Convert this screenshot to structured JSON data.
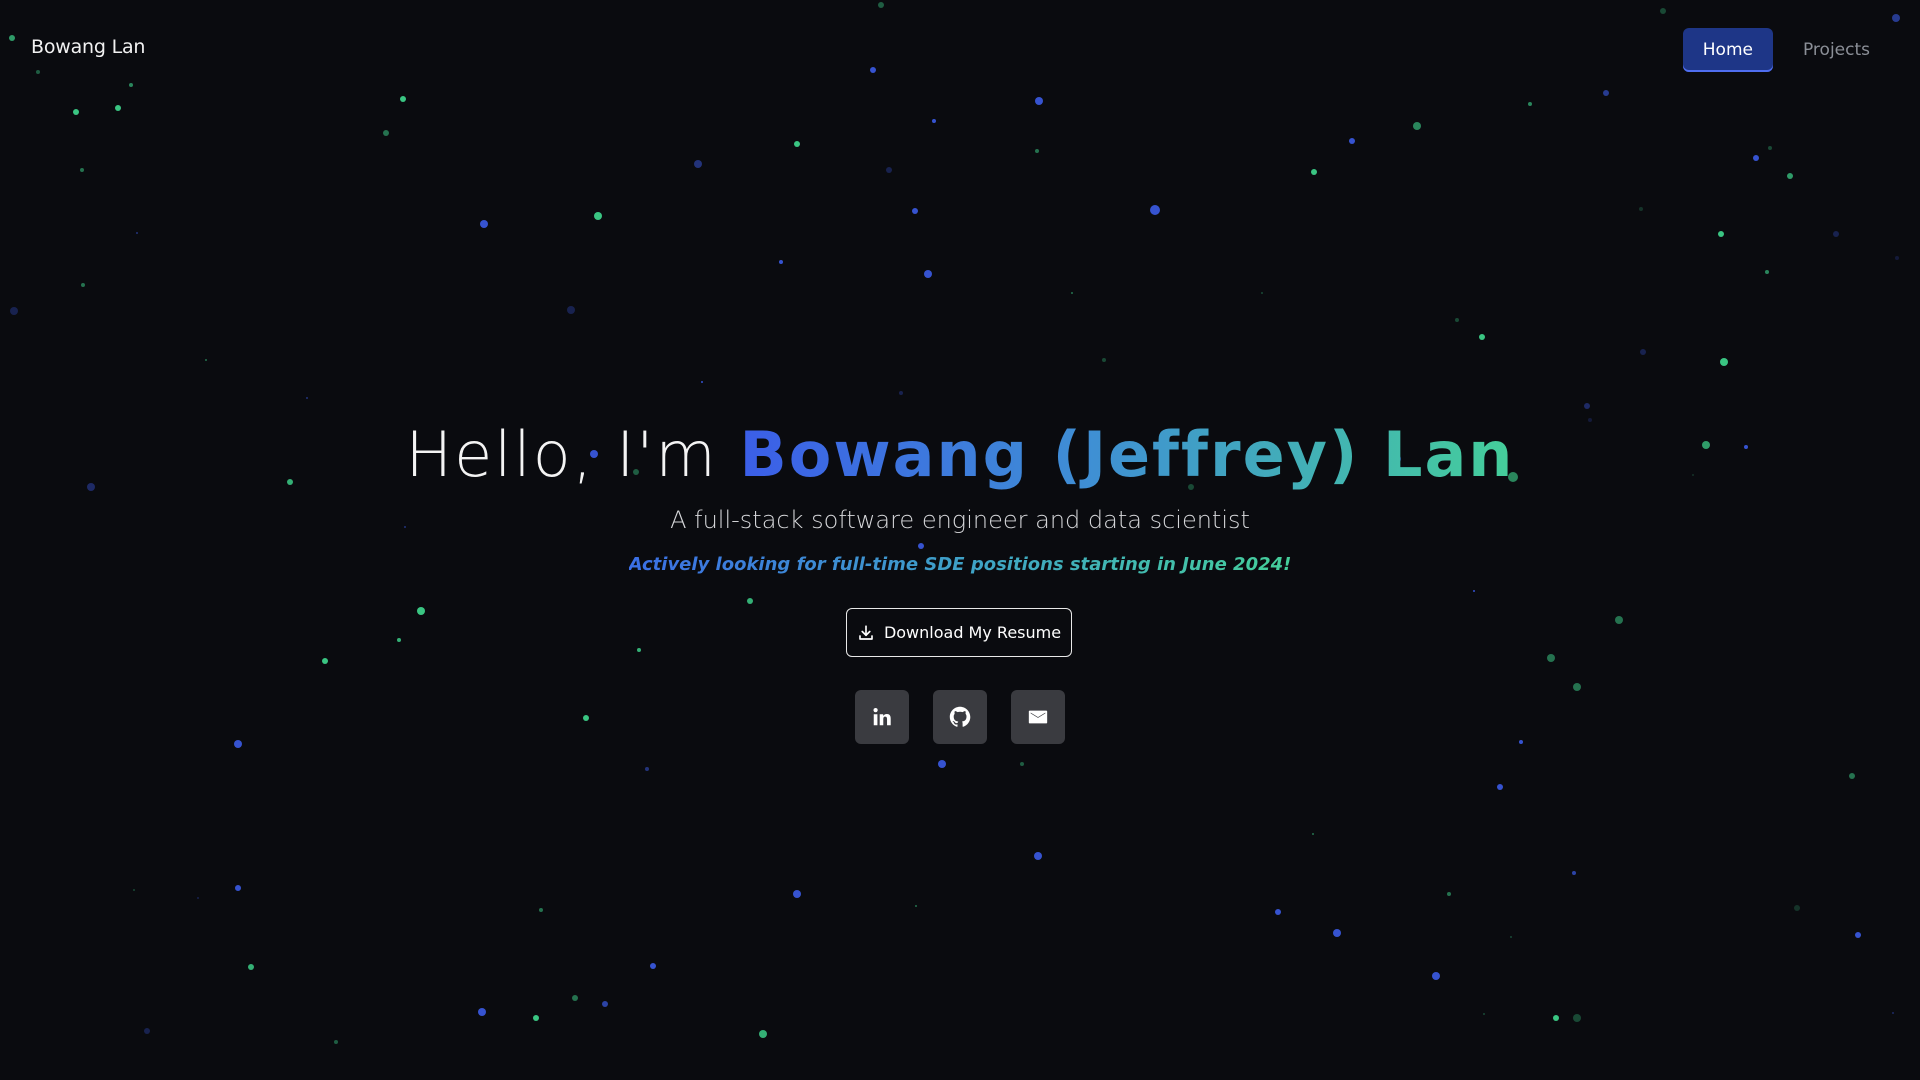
{
  "brand": {
    "name": "Bowang Lan"
  },
  "nav": {
    "items": [
      {
        "label": "Home",
        "active": true
      },
      {
        "label": "Projects",
        "active": false
      }
    ]
  },
  "hero": {
    "greeting": "Hello, I'm ",
    "name": "Bowang (Jeffrey) Lan",
    "subtitle": "A full-stack software engineer and data scientist",
    "looking": "Actively looking for full-time SDE positions starting in June 2024!",
    "resume_button": "Download My Resume"
  },
  "socials": [
    {
      "icon": "linkedin-icon"
    },
    {
      "icon": "github-icon"
    },
    {
      "icon": "mail-icon"
    }
  ],
  "colors": {
    "background": "#0a0b0f",
    "nav_active": "#1e3687",
    "particle_blue": "#3b5be6",
    "particle_green": "#3fd98f",
    "social_button": "#3a3b40"
  }
}
